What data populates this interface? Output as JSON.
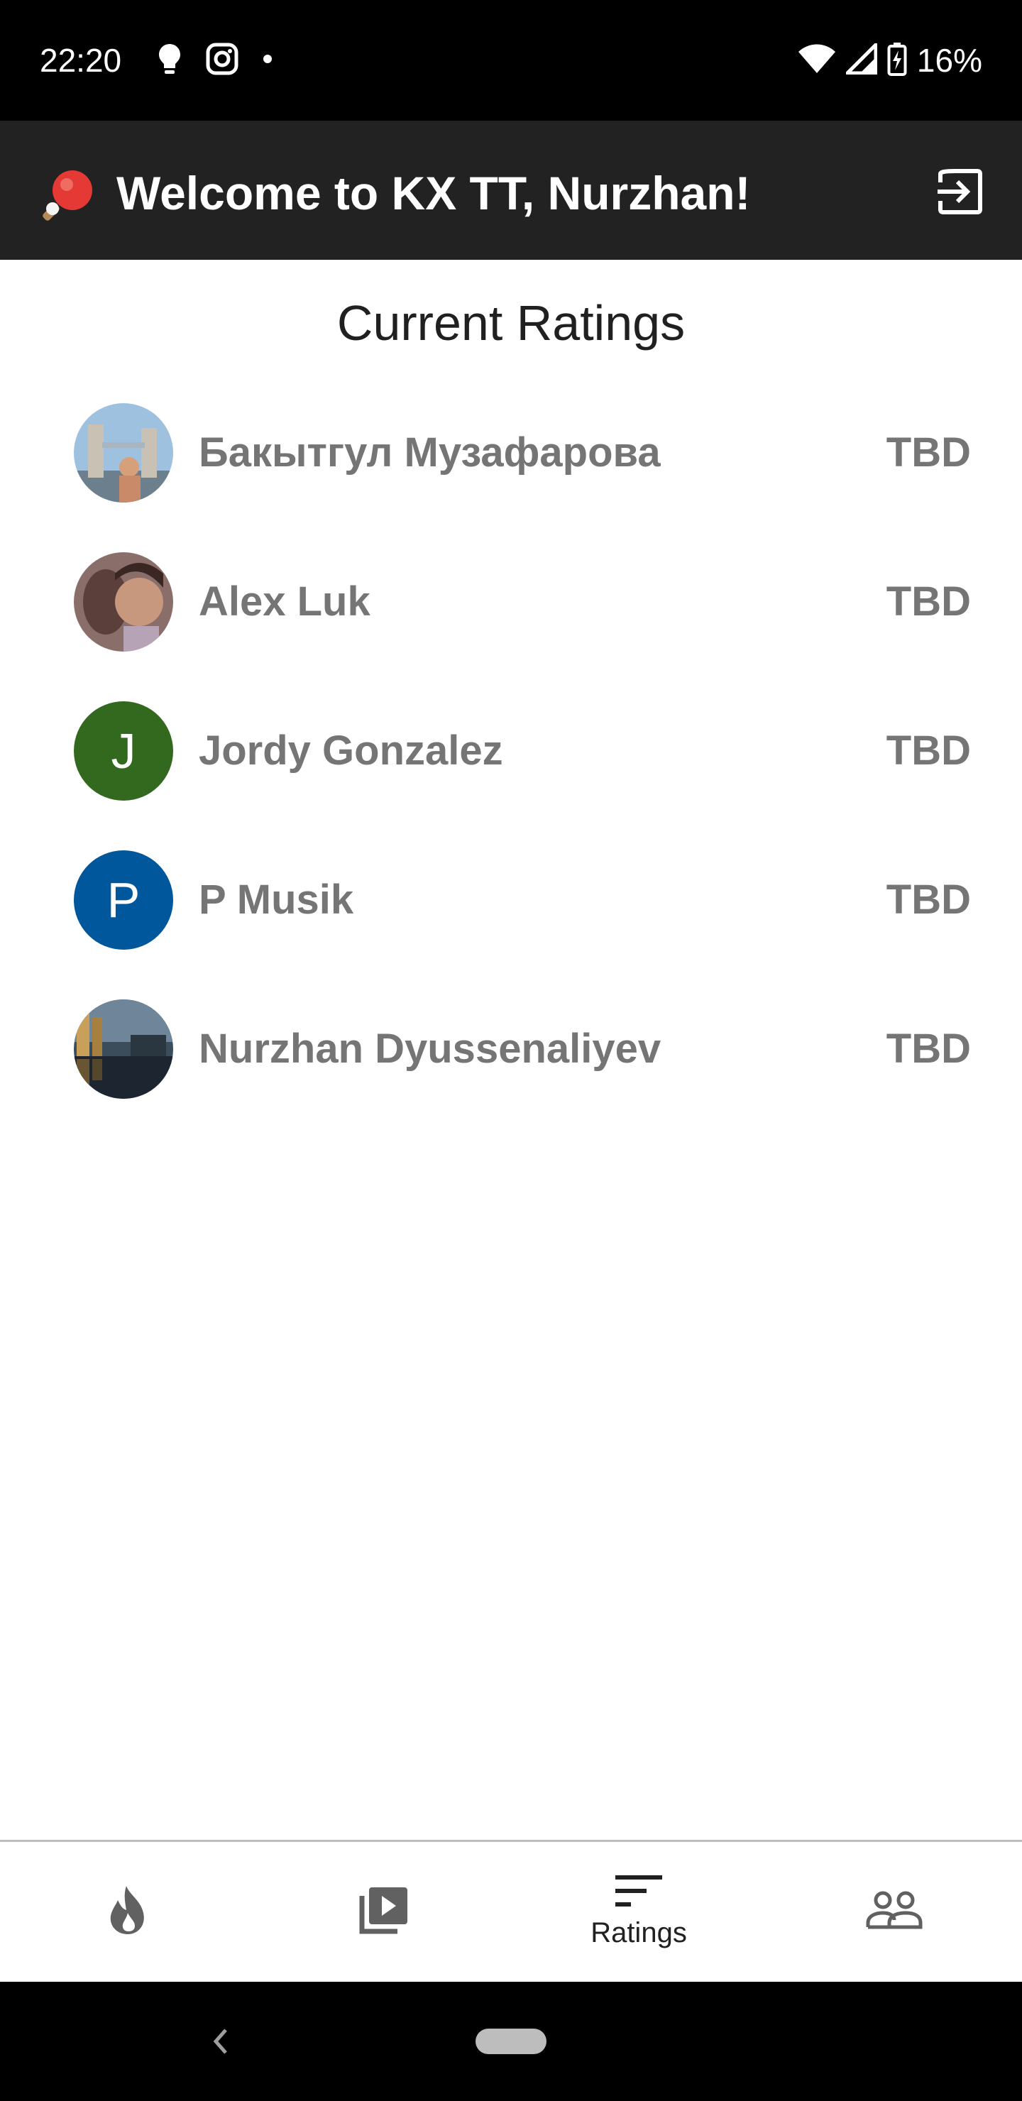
{
  "status_bar": {
    "time": "22:20",
    "left_icons": [
      "lightbulb-icon",
      "instagram-icon",
      "dot-icon"
    ],
    "right_icons": [
      "wifi-icon",
      "signal-icon",
      "battery-charging-icon"
    ],
    "battery": "16%"
  },
  "app_bar": {
    "logo_icon": "ping-pong-icon",
    "title": "Welcome to KX TT, Nurzhan!",
    "logout_icon": "logout-icon"
  },
  "main": {
    "title": "Current Ratings",
    "players": [
      {
        "name": "Бакытгул Музафарова",
        "rating": "TBD",
        "avatar_initial": "",
        "avatar_color": "#7a9ab8"
      },
      {
        "name": "Alex Luk",
        "rating": "TBD",
        "avatar_initial": "",
        "avatar_color": "#9a7c74"
      },
      {
        "name": "Jordy Gonzalez",
        "rating": "TBD",
        "avatar_initial": "J",
        "avatar_color": "#33691e"
      },
      {
        "name": "P Musik",
        "rating": "TBD",
        "avatar_initial": "P",
        "avatar_color": "#01579b"
      },
      {
        "name": "Nurzhan Dyussenaliyev",
        "rating": "TBD",
        "avatar_initial": "",
        "avatar_color": "#2c3a44"
      }
    ]
  },
  "bottom_nav": {
    "items": [
      {
        "icon": "flame-icon",
        "label": ""
      },
      {
        "icon": "video-library-icon",
        "label": ""
      },
      {
        "icon": "sort-icon",
        "label": "Ratings"
      },
      {
        "icon": "people-icon",
        "label": ""
      }
    ],
    "active_index": 2
  },
  "system_nav": {
    "back_icon": "back-chevron-icon",
    "home_icon": "home-pill-icon"
  }
}
